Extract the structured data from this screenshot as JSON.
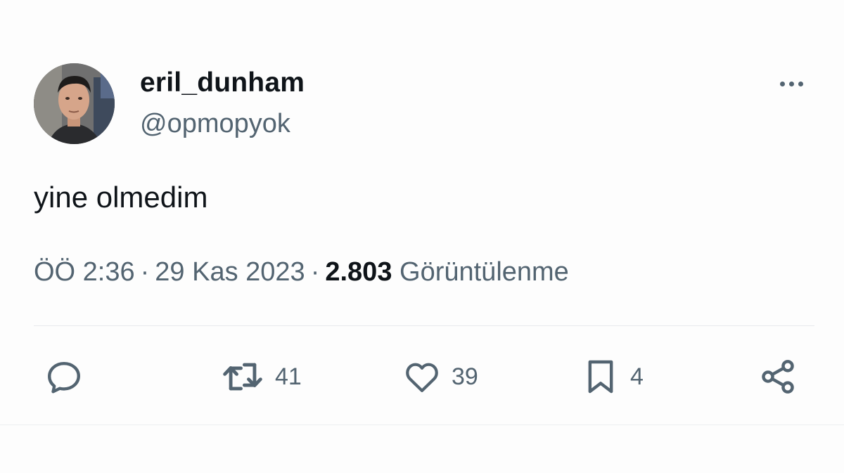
{
  "tweet": {
    "author": {
      "display_name": "eril_dunham",
      "handle": "@opmopyok"
    },
    "text": "yine olmedim",
    "meta": {
      "time": "ÖÖ 2:36",
      "separator": "·",
      "date": "29 Kas 2023",
      "views_count": "2.803",
      "views_label": "Görüntülenme"
    },
    "actions": {
      "reply": {
        "icon": "reply-icon",
        "count": ""
      },
      "retweet": {
        "icon": "retweet-icon",
        "count": "41"
      },
      "like": {
        "icon": "heart-icon",
        "count": "39"
      },
      "bookmark": {
        "icon": "bookmark-icon",
        "count": "4"
      },
      "share": {
        "icon": "share-icon",
        "count": ""
      }
    }
  },
  "colors": {
    "background": "#fdfdfd",
    "primary_text": "#0f1419",
    "secondary_text": "#536471",
    "divider": "#e8eaec"
  }
}
